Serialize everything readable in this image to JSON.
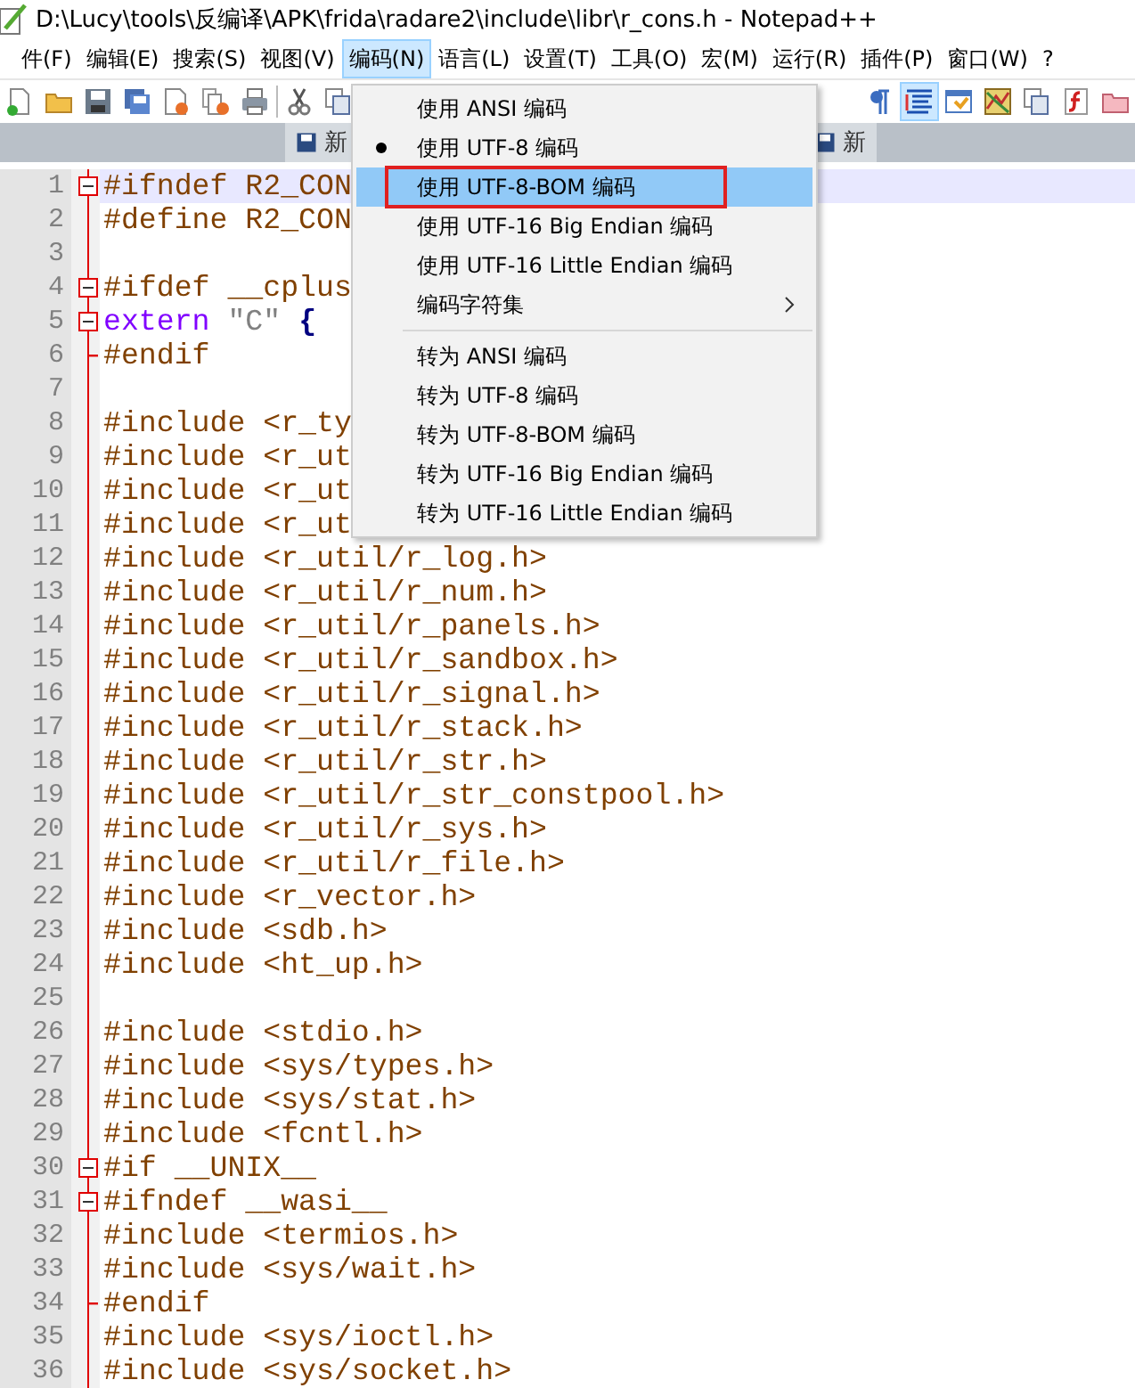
{
  "window": {
    "title": "D:\\Lucy\\tools\\反编译\\APK\\frida\\radare2\\include\\libr\\r_cons.h - Notepad++"
  },
  "menu_bar": [
    {
      "label": "件(F)",
      "selected": false
    },
    {
      "label": "编辑(E)",
      "selected": false
    },
    {
      "label": "搜索(S)",
      "selected": false
    },
    {
      "label": "视图(V)",
      "selected": false
    },
    {
      "label": "编码(N)",
      "selected": true
    },
    {
      "label": "语言(L)",
      "selected": false
    },
    {
      "label": "设置(T)",
      "selected": false
    },
    {
      "label": "工具(O)",
      "selected": false
    },
    {
      "label": "宏(M)",
      "selected": false
    },
    {
      "label": "运行(R)",
      "selected": false
    },
    {
      "label": "插件(P)",
      "selected": false
    },
    {
      "label": "窗口(W)",
      "selected": false
    },
    {
      "label": "?",
      "selected": false
    }
  ],
  "toolbar_left": [
    {
      "kind": "new"
    },
    {
      "kind": "open"
    },
    {
      "kind": "save"
    },
    {
      "kind": "save-all"
    },
    {
      "kind": "close"
    },
    {
      "kind": "close-all"
    },
    {
      "kind": "print"
    },
    {
      "kind": "separator"
    },
    {
      "kind": "cut"
    },
    {
      "kind": "copy"
    }
  ],
  "toolbar_right": [
    {
      "kind": "pilcrow"
    },
    {
      "kind": "wrap",
      "on": true
    },
    {
      "kind": "panel"
    },
    {
      "kind": "map"
    },
    {
      "kind": "copy"
    },
    {
      "kind": "function"
    },
    {
      "kind": "folder"
    }
  ],
  "tabs": [
    {
      "label": "新"
    },
    {
      "label": "新"
    }
  ],
  "dropdown": {
    "items": [
      {
        "kind": "item",
        "label": "使用 ANSI 编码",
        "checked": false,
        "selected": false
      },
      {
        "kind": "item",
        "label": "使用 UTF-8 编码",
        "checked": true,
        "selected": false
      },
      {
        "kind": "item",
        "label": "使用 UTF-8-BOM 编码",
        "checked": false,
        "selected": true
      },
      {
        "kind": "item",
        "label": "使用 UTF-16 Big Endian 编码",
        "checked": false,
        "selected": false
      },
      {
        "kind": "item",
        "label": "使用 UTF-16 Little Endian 编码",
        "checked": false,
        "selected": false
      },
      {
        "kind": "submenu",
        "label": "编码字符集",
        "checked": false,
        "selected": false
      },
      {
        "kind": "separator"
      },
      {
        "kind": "item",
        "label": "转为 ANSI 编码",
        "checked": false,
        "selected": false
      },
      {
        "kind": "item",
        "label": "转为 UTF-8 编码",
        "checked": false,
        "selected": false
      },
      {
        "kind": "item",
        "label": "转为 UTF-8-BOM 编码",
        "checked": false,
        "selected": false
      },
      {
        "kind": "item",
        "label": "转为 UTF-16 Big Endian 编码",
        "checked": false,
        "selected": false
      },
      {
        "kind": "item",
        "label": "转为 UTF-16 Little Endian 编码",
        "checked": false,
        "selected": false
      }
    ]
  },
  "editor": {
    "lines": [
      {
        "number": "1",
        "kind": "fold-start",
        "current": true,
        "text": "#ifndef R2_CON"
      },
      {
        "number": "2",
        "kind": "plain",
        "current": false,
        "text": "#define R2_CON"
      },
      {
        "number": "3",
        "kind": "plain",
        "current": false
      },
      {
        "number": "4",
        "kind": "fold-start",
        "current": false,
        "text": "#ifdef __cplus"
      },
      {
        "number": "5",
        "kind": "fold-start",
        "current": false,
        "segments": [
          {
            "text": "extern",
            "kind": "keyword"
          },
          {
            "text": "\"C\"",
            "kind": "string"
          },
          {
            "text": "{",
            "kind": "operator"
          }
        ]
      },
      {
        "number": "6",
        "kind": "fold-end",
        "current": false,
        "text": "#endif"
      },
      {
        "number": "7",
        "kind": "plain",
        "current": false
      },
      {
        "number": "8",
        "kind": "plain",
        "current": false,
        "text": "#include <r_ty"
      },
      {
        "number": "9",
        "kind": "plain",
        "current": false,
        "text": "#include <r_ut"
      },
      {
        "number": "10",
        "kind": "plain",
        "current": false,
        "text": "#include <r_ut"
      },
      {
        "number": "11",
        "kind": "plain",
        "current": false,
        "text": "#include <r_ut"
      },
      {
        "number": "12",
        "kind": "plain",
        "current": false,
        "text": "#include <r_util/r_log.h>"
      },
      {
        "number": "13",
        "kind": "plain",
        "current": false,
        "text": "#include <r_util/r_num.h>"
      },
      {
        "number": "14",
        "kind": "plain",
        "current": false,
        "text": "#include <r_util/r_panels.h>"
      },
      {
        "number": "15",
        "kind": "plain",
        "current": false,
        "text": "#include <r_util/r_sandbox.h>"
      },
      {
        "number": "16",
        "kind": "plain",
        "current": false,
        "text": "#include <r_util/r_signal.h>"
      },
      {
        "number": "17",
        "kind": "plain",
        "current": false,
        "text": "#include <r_util/r_stack.h>"
      },
      {
        "number": "18",
        "kind": "plain",
        "current": false,
        "text": "#include <r_util/r_str.h>"
      },
      {
        "number": "19",
        "kind": "plain",
        "current": false,
        "text": "#include <r_util/r_str_constpool.h>"
      },
      {
        "number": "20",
        "kind": "plain",
        "current": false,
        "text": "#include <r_util/r_sys.h>"
      },
      {
        "number": "21",
        "kind": "plain",
        "current": false,
        "text": "#include <r_util/r_file.h>"
      },
      {
        "number": "22",
        "kind": "plain",
        "current": false,
        "text": "#include <r_vector.h>"
      },
      {
        "number": "23",
        "kind": "plain",
        "current": false,
        "text": "#include <sdb.h>"
      },
      {
        "number": "24",
        "kind": "plain",
        "current": false,
        "text": "#include <ht_up.h>"
      },
      {
        "number": "25",
        "kind": "plain",
        "current": false
      },
      {
        "number": "26",
        "kind": "plain",
        "current": false,
        "text": "#include <stdio.h>"
      },
      {
        "number": "27",
        "kind": "plain",
        "current": false,
        "text": "#include <sys/types.h>"
      },
      {
        "number": "28",
        "kind": "plain",
        "current": false,
        "text": "#include <sys/stat.h>"
      },
      {
        "number": "29",
        "kind": "plain",
        "current": false,
        "text": "#include <fcntl.h>"
      },
      {
        "number": "30",
        "kind": "fold-start",
        "current": false,
        "text": "#if __UNIX__"
      },
      {
        "number": "31",
        "kind": "fold-start",
        "current": false,
        "text": "#ifndef __wasi__"
      },
      {
        "number": "32",
        "kind": "plain",
        "current": false,
        "text": "#include <termios.h>"
      },
      {
        "number": "33",
        "kind": "plain",
        "current": false,
        "text": "#include <sys/wait.h>"
      },
      {
        "number": "34",
        "kind": "fold-end",
        "current": false,
        "text": "#endif"
      },
      {
        "number": "35",
        "kind": "plain",
        "current": false,
        "text": "#include <sys/ioctl.h>"
      },
      {
        "number": "36",
        "kind": "plain",
        "current": false,
        "text": "#include <sys/socket.h>"
      }
    ]
  }
}
